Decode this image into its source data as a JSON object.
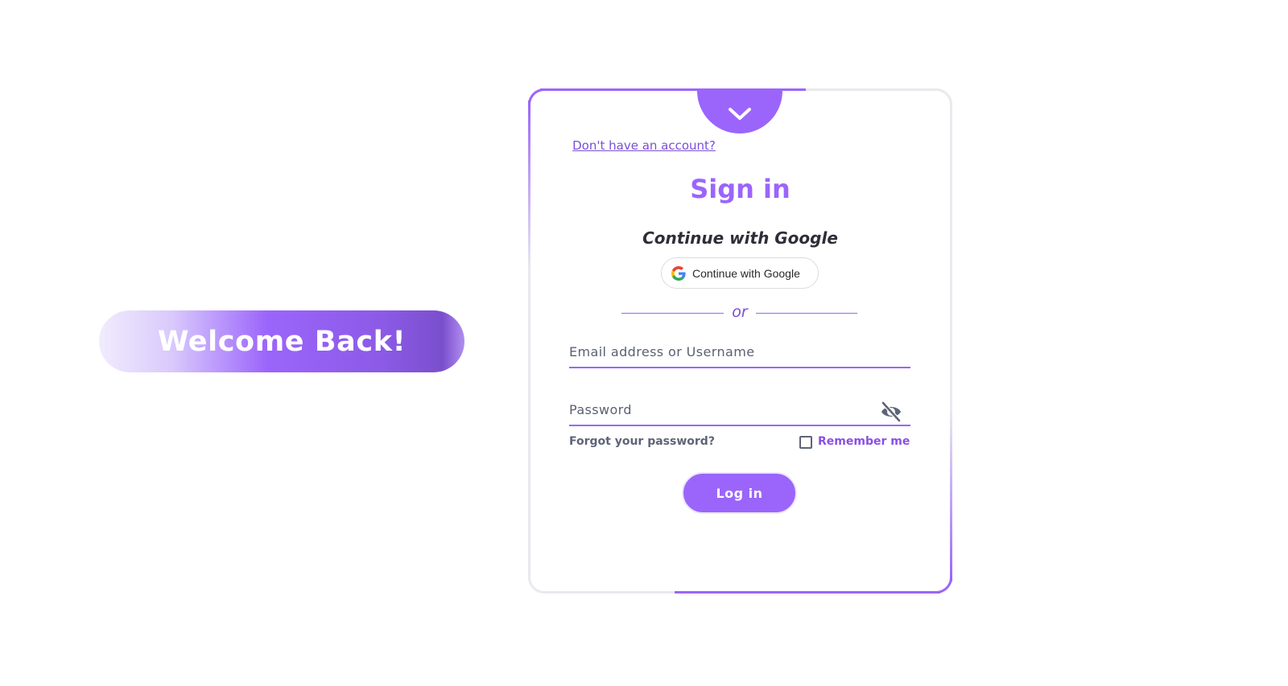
{
  "welcome": {
    "text": "Welcome Back!"
  },
  "card": {
    "toggle_icon": "chevron-down-icon",
    "signup_link": "Don't have an account?",
    "title": "Sign in",
    "google_heading": "Continue with Google",
    "google_button_label": "Continue with Google",
    "divider_text": "or",
    "email": {
      "placeholder": "Email address or Username",
      "value": ""
    },
    "password": {
      "placeholder": "Password",
      "value": "",
      "toggle_icon": "eye-off-icon"
    },
    "forgot_label": "Forgot your password?",
    "remember_label": "Remember me",
    "remember_checked": false,
    "login_label": "Log in"
  },
  "colors": {
    "accent": "#9b65fb",
    "accent_dark": "#7b4fd6",
    "text_dark": "#2e2e3a",
    "muted": "#5e6478",
    "border": "#e9e9ee"
  }
}
